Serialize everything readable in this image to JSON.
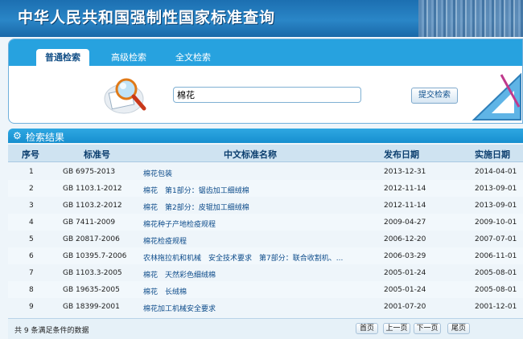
{
  "header": {
    "title": "中华人民共和国强制性国家标准查询"
  },
  "tabs": [
    {
      "label": "普通检索",
      "active": true
    },
    {
      "label": "高级检索",
      "active": false
    },
    {
      "label": "全文检索",
      "active": false
    }
  ],
  "search": {
    "value": "棉花",
    "submit_label": "提交检索"
  },
  "results": {
    "title": "检索结果",
    "columns": [
      "序号",
      "标准号",
      "中文标准名称",
      "发布日期",
      "实施日期"
    ],
    "rows": [
      {
        "no": "1",
        "code": "GB 6975-2013",
        "name": "棉花包装",
        "pub": "2013-12-31",
        "eff": "2014-04-01"
      },
      {
        "no": "2",
        "code": "GB 1103.1-2012",
        "name": "棉花　第1部分：锯齿加工细绒棉",
        "pub": "2012-11-14",
        "eff": "2013-09-01"
      },
      {
        "no": "3",
        "code": "GB 1103.2-2012",
        "name": "棉花　第2部分：皮辊加工细绒棉",
        "pub": "2012-11-14",
        "eff": "2013-09-01"
      },
      {
        "no": "4",
        "code": "GB 7411-2009",
        "name": "棉花种子产地检疫规程",
        "pub": "2009-04-27",
        "eff": "2009-10-01"
      },
      {
        "no": "5",
        "code": "GB 20817-2006",
        "name": "棉花检疫规程",
        "pub": "2006-12-20",
        "eff": "2007-07-01"
      },
      {
        "no": "6",
        "code": "GB 10395.7-2006",
        "name": "农林拖拉机和机械　安全技术要求　第7部分：联合收割机、...",
        "pub": "2006-03-29",
        "eff": "2006-11-01"
      },
      {
        "no": "7",
        "code": "GB 1103.3-2005",
        "name": "棉花　天然彩色细绒棉",
        "pub": "2005-01-24",
        "eff": "2005-08-01"
      },
      {
        "no": "8",
        "code": "GB 19635-2005",
        "name": "棉花　长绒棉",
        "pub": "2005-01-24",
        "eff": "2005-08-01"
      },
      {
        "no": "9",
        "code": "GB 18399-2001",
        "name": "棉花加工机械安全要求",
        "pub": "2001-07-20",
        "eff": "2001-12-01"
      }
    ]
  },
  "footer": {
    "count_text": "共 9 条满足条件的数据",
    "first": "首页",
    "prev": "上一页",
    "next": "下一页",
    "last": "尾页"
  },
  "icons": {
    "magnifier": "magnifier-icon",
    "ruler": "ruler-triangle-icon",
    "gear": "gear-icon"
  }
}
